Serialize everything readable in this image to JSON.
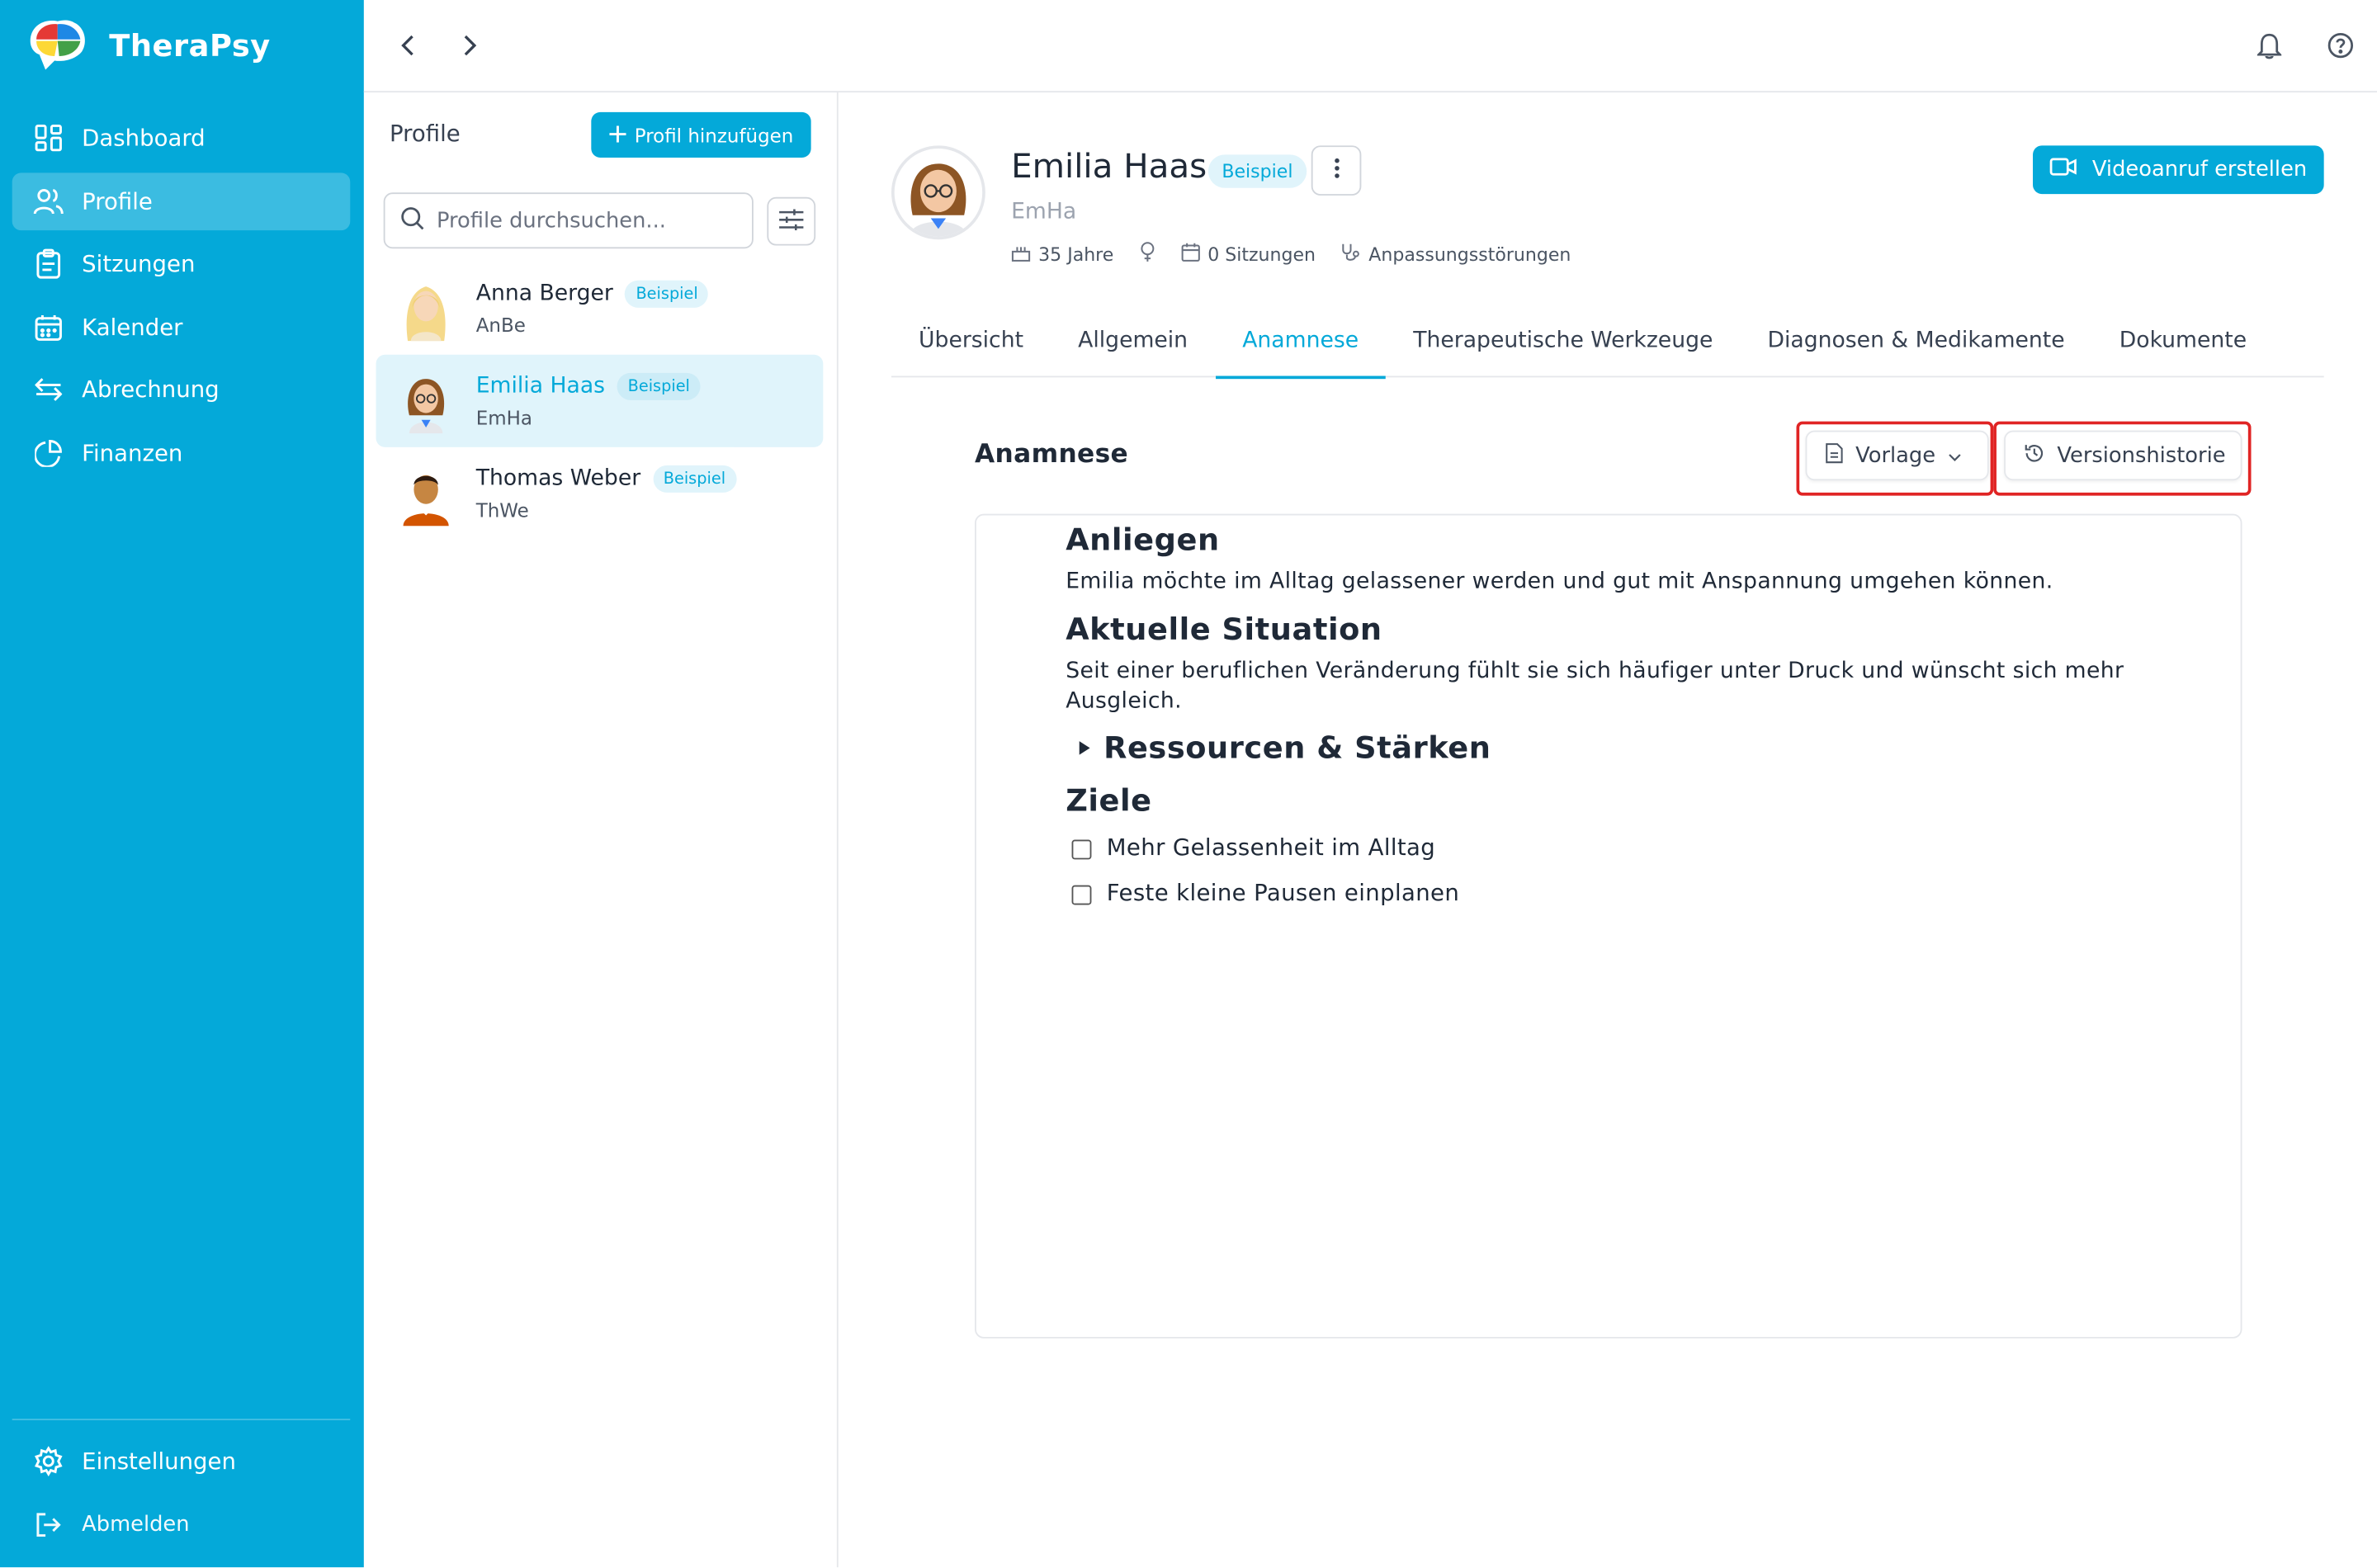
{
  "app": {
    "name": "TheraPsy",
    "accent": "#04a9d9"
  },
  "sidebar": {
    "items": [
      {
        "label": "Dashboard",
        "icon": "dashboard-icon"
      },
      {
        "label": "Profile",
        "icon": "users-icon",
        "active": true
      },
      {
        "label": "Sitzungen",
        "icon": "clipboard-icon"
      },
      {
        "label": "Kalender",
        "icon": "calendar-icon"
      },
      {
        "label": "Abrechnung",
        "icon": "arrows-exchange-icon"
      },
      {
        "label": "Finanzen",
        "icon": "pie-chart-icon"
      }
    ],
    "settings": "Einstellungen",
    "logout": "Abmelden"
  },
  "profiles": {
    "title": "Profile",
    "add_label": "Profil hinzufügen",
    "search_placeholder": "Profile durchsuchen...",
    "list": [
      {
        "name": "Anna Berger",
        "short": "AnBe",
        "badge": "Beispiel"
      },
      {
        "name": "Emilia Haas",
        "short": "EmHa",
        "badge": "Beispiel",
        "active": true
      },
      {
        "name": "Thomas Weber",
        "short": "ThWe",
        "badge": "Beispiel"
      }
    ]
  },
  "patient": {
    "name": "Emilia Haas",
    "badge": "Beispiel",
    "short": "EmHa",
    "age": "35 Jahre",
    "sessions": "0 Sitzungen",
    "diagnosis": "Anpassungsstörungen",
    "video_label": "Videoanruf erstellen"
  },
  "tabs": [
    "Übersicht",
    "Allgemein",
    "Anamnese",
    "Therapeutische Werkzeuge",
    "Diagnosen & Medikamente",
    "Dokumente"
  ],
  "active_tab": "Anamnese",
  "anamnese": {
    "title": "Anamnese",
    "template_label": "Vorlage",
    "history_label": "Versionshistorie",
    "h_anliegen": "Anliegen",
    "p_anliegen": "Emilia möchte im Alltag gelassener werden und gut mit Anspannung umgehen können.",
    "h_situation": "Aktuelle Situation",
    "p_situation": "Seit einer beruflichen Veränderung fühlt sie sich häufiger unter Druck und wünscht sich mehr Ausgleich.",
    "h_ressourcen": "Ressourcen & Stärken",
    "h_ziele": "Ziele",
    "goals": [
      "Mehr Gelassenheit im Alltag",
      "Feste kleine Pausen einplanen"
    ]
  }
}
